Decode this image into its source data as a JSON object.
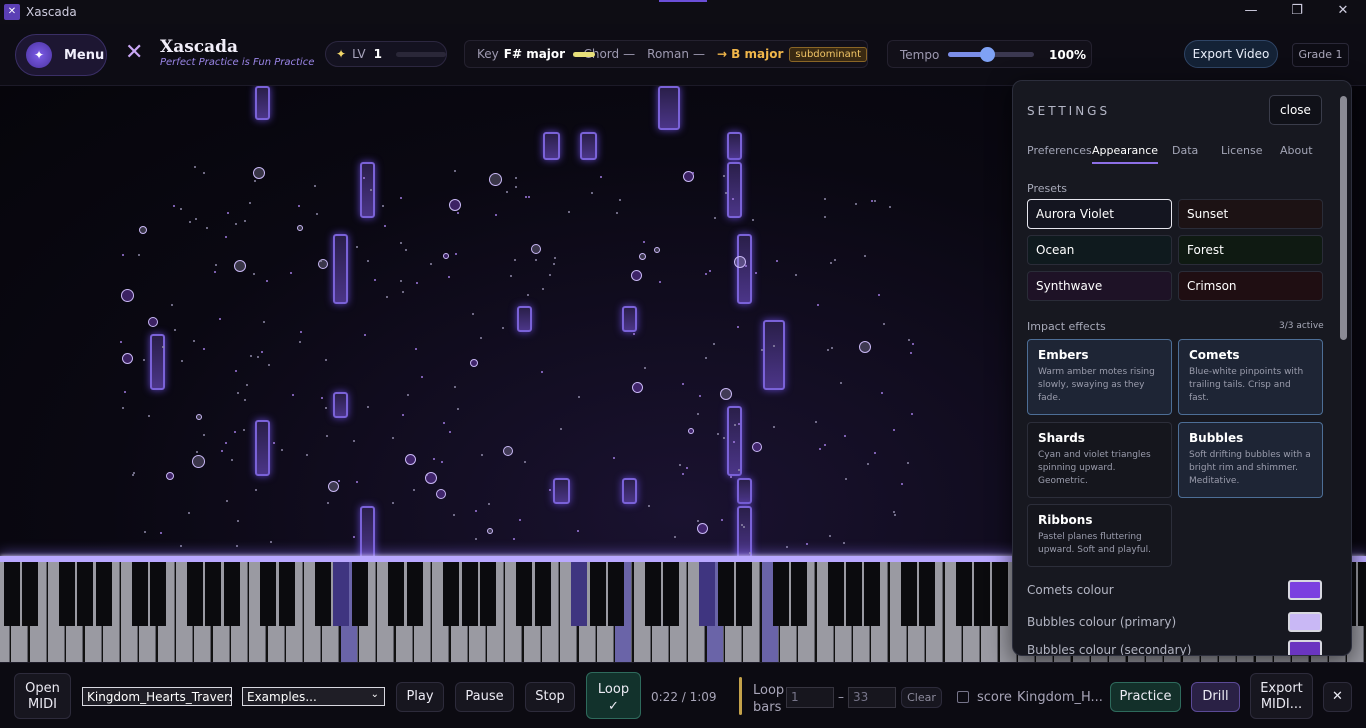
{
  "window": {
    "title": "Xascada",
    "min": "—",
    "max": "❐",
    "close": "✕"
  },
  "header": {
    "menu_label": "Menu",
    "brand": "Xascada",
    "tagline": "Perfect Practice is Fun Practice",
    "level": {
      "star": "✦",
      "label": "LV",
      "value": "1",
      "progress": 0
    },
    "key": {
      "key_label": "Key",
      "key_value": "F# major",
      "key_meter": 0.8,
      "chord_label": "Chord",
      "chord_value": "—",
      "roman_label": "Roman",
      "roman_value": "—",
      "target": "→ B major",
      "function": "subdominant"
    },
    "tempo": {
      "label": "Tempo",
      "value": "100%",
      "level": 0.45
    },
    "export_video": "Export Video",
    "grade": "Grade 1"
  },
  "settings": {
    "heading": "SETTINGS",
    "close": "close",
    "tabs": [
      "Preferences",
      "Appearance",
      "Data",
      "License",
      "About"
    ],
    "active_tab": "Appearance",
    "presets_label": "Presets",
    "presets": [
      {
        "name": "Aurora Violet",
        "bg": "#141520",
        "selected": true
      },
      {
        "name": "Sunset",
        "bg": "#1c1214",
        "selected": false
      },
      {
        "name": "Ocean",
        "bg": "#0f1a1e",
        "selected": false
      },
      {
        "name": "Forest",
        "bg": "#0f1a12",
        "selected": false
      },
      {
        "name": "Synthwave",
        "bg": "#1e1226",
        "selected": false
      },
      {
        "name": "Crimson",
        "bg": "#1f0e12",
        "selected": false
      }
    ],
    "impact_label": "Impact effects",
    "impact_count": "3/3 active",
    "effects": [
      {
        "title": "Embers",
        "desc": "Warm amber motes rising slowly, swaying as they fade.",
        "active": true
      },
      {
        "title": "Comets",
        "desc": "Blue-white pinpoints with trailing tails. Crisp and fast.",
        "active": true
      },
      {
        "title": "Shards",
        "desc": "Cyan and violet triangles spinning upward. Geometric.",
        "active": false
      },
      {
        "title": "Bubbles",
        "desc": "Soft drifting bubbles with a bright rim and shimmer. Meditative.",
        "active": true
      },
      {
        "title": "Ribbons",
        "desc": "Pastel planes fluttering upward. Soft and playful.",
        "active": false
      }
    ],
    "colors": [
      {
        "label": "Comets colour",
        "value": "#7b3fe0"
      },
      {
        "label": "Bubbles colour (primary)",
        "value": "#c9b8f5"
      },
      {
        "label": "Bubbles colour (secondary)",
        "value": "#6a35c0"
      }
    ]
  },
  "bottom": {
    "open_midi": [
      "Open",
      "MIDI"
    ],
    "file_value": "Kingdom_Hearts_Traverse",
    "examples_value": "Examples...",
    "play": "Play",
    "pause": "Pause",
    "stop": "Stop",
    "loop": [
      "Loop",
      "✓"
    ],
    "time": "0:22 / 1:09",
    "loop_bars": [
      "Loop",
      "bars"
    ],
    "loop_from": "1",
    "loop_dash": "–",
    "loop_to": "33",
    "clear": "Clear",
    "score_label": "score",
    "song_short": "Kingdom_H...",
    "practice": "Practice",
    "drill": "Drill",
    "export_midi": [
      "Export",
      "MIDI..."
    ],
    "close": "✕"
  },
  "colors": {
    "accent": "#8d6fe6",
    "note_fill": "#4b3588",
    "hitline": "#b9a8ff"
  }
}
